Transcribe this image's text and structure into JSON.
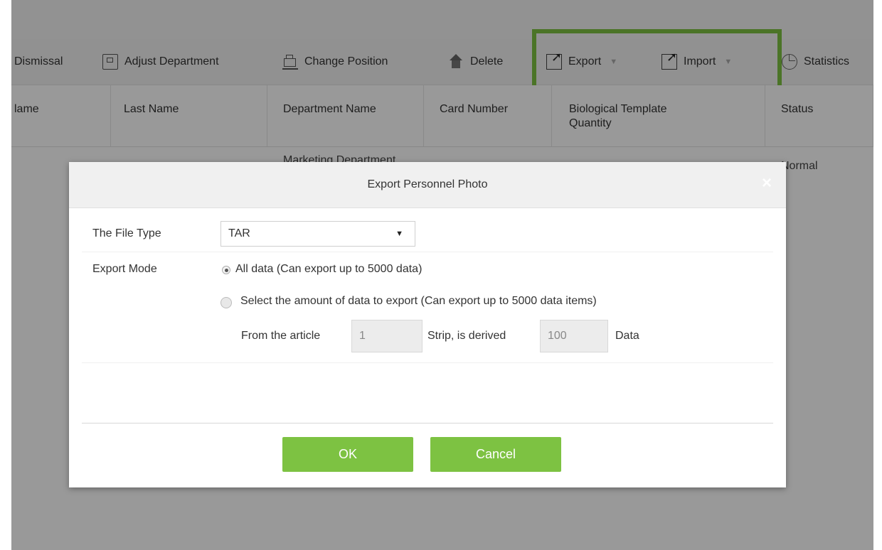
{
  "toolbar": {
    "items": [
      {
        "label": "Dismissal",
        "icon": "dismissal-icon"
      },
      {
        "label": "Adjust Department",
        "icon": "adjust-department-icon"
      },
      {
        "label": "Change Position",
        "icon": "change-position-icon"
      },
      {
        "label": "Delete",
        "icon": "delete-icon"
      },
      {
        "label": "Export",
        "icon": "export-icon",
        "dropdown": true
      },
      {
        "label": "Import",
        "icon": "import-icon",
        "dropdown": true
      },
      {
        "label": "Statistics",
        "icon": "statistics-icon"
      }
    ],
    "highlight_color": "#7dc242"
  },
  "table": {
    "headers": [
      "lame",
      "Last Name",
      "Department Name",
      "Card Number",
      "Biological Template Quantity",
      "Status"
    ],
    "row1": {
      "department": "Marketing Department",
      "status": "Normal"
    }
  },
  "modal": {
    "title": "Export Personnel Photo",
    "close_glyph": "×",
    "file_type_label": "The File Type",
    "file_type_value": "TAR",
    "export_mode_label": "Export Mode",
    "option_all": "All data (Can export up to 5000 data)",
    "option_select": "Select the amount of data to export (Can export up to 5000 data items)",
    "from_label": "From the article",
    "from_value": "1",
    "strip_label": "Strip, is derived",
    "count_value": "100",
    "data_label": "Data",
    "ok_label": "OK",
    "cancel_label": "Cancel",
    "button_color": "#7dc242"
  }
}
